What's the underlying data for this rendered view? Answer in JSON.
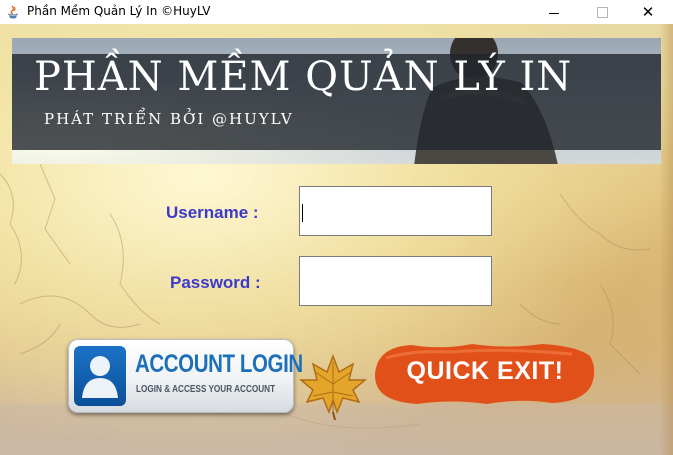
{
  "window": {
    "title": "Phần Mềm Quản Lý In ©HuyLV",
    "controls": {
      "minimize": "minimize-icon",
      "maximize": "maximize-icon",
      "close": "✕"
    }
  },
  "banner": {
    "title": "PHẦN MỀM QUẢN LÝ IN",
    "subtitle": "PHÁT TRIỂN BỞI @HUYLV"
  },
  "form": {
    "username_label": "Username :",
    "username_value": "",
    "password_label": "Password :",
    "password_value": ""
  },
  "buttons": {
    "login_title": "ACCOUNT LOGIN",
    "login_subtitle": "LOGIN & ACCESS YOUR ACCOUNT",
    "exit_label": "QUICK EXIT!"
  },
  "colors": {
    "label_text": "#3a3acb",
    "login_title": "#1d6fb8",
    "exit_button": "#e2501a",
    "banner_overlay": "#20262c"
  }
}
